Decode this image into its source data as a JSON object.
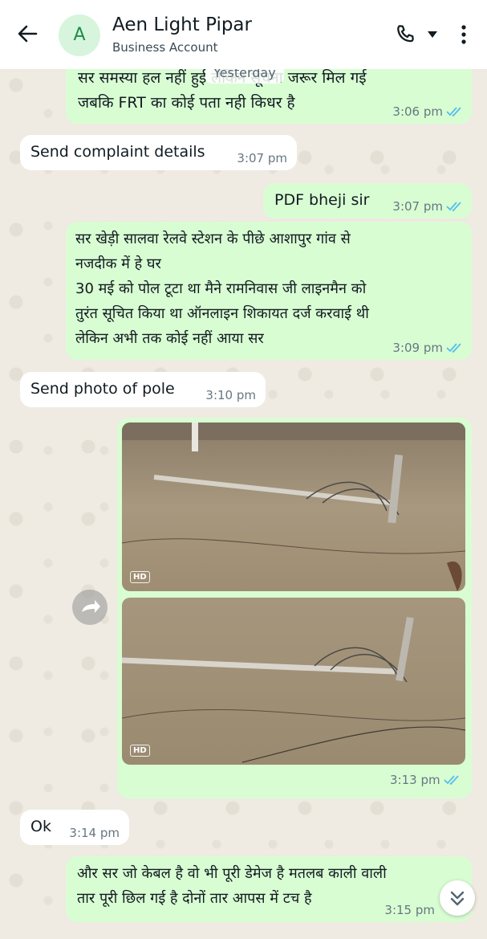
{
  "header": {
    "avatar_letter": "A",
    "contact_name": "Aen Light Pipar",
    "contact_sub": "Business Account",
    "icons": [
      "back-arrow-icon",
      "phone-icon",
      "chevron-down-icon",
      "more-vert-icon"
    ]
  },
  "day_chip": "Yesterday",
  "messages": [
    {
      "dir": "out",
      "text": "सर समस्या हल नहीं हुई लेकिन सूचना जरूर मिल गई\nजबकि FRT का कोई पता नही किधर है",
      "time": "3:06 pm",
      "read": true
    },
    {
      "dir": "in",
      "text": "Send complaint details",
      "time": "3:07 pm"
    },
    {
      "dir": "out",
      "text": "PDF bheji sir",
      "time": "3:07 pm",
      "read": true
    },
    {
      "dir": "out",
      "text": "सर खेड़ी सालवा रेलवे स्टेशन के पीछे आशापुर गांव से\nनजदीक में हे घर\n30 मई को पोल टूटा था मैने रामनिवास जी लाइनमैन को\nतुरंत सूचित किया था ऑनलाइन शिकायत दर्ज करवाई थी\nलेकिन अभी तक कोई नहीं आया सर",
      "time": "3:09 pm",
      "read": true
    },
    {
      "dir": "in",
      "text": "Send photo of pole",
      "time": "3:10 pm"
    },
    {
      "dir": "out",
      "type": "photos",
      "badge": "HD",
      "time": "3:13 pm",
      "read": true
    },
    {
      "dir": "in",
      "text": "Ok",
      "time": "3:14 pm"
    },
    {
      "dir": "out",
      "text": "और सर जो केबल है वो भी पूरी डेमेज है मतलब काली वाली\nतार पूरी छिल गई है दोनों तार आपस में टच है",
      "time": "3:15 pm",
      "read": true
    }
  ],
  "colors": {
    "outgoing": "#d9fdd3",
    "incoming": "#ffffff",
    "read_ticks": "#53bdeb",
    "accent": "#1d8d4b"
  }
}
